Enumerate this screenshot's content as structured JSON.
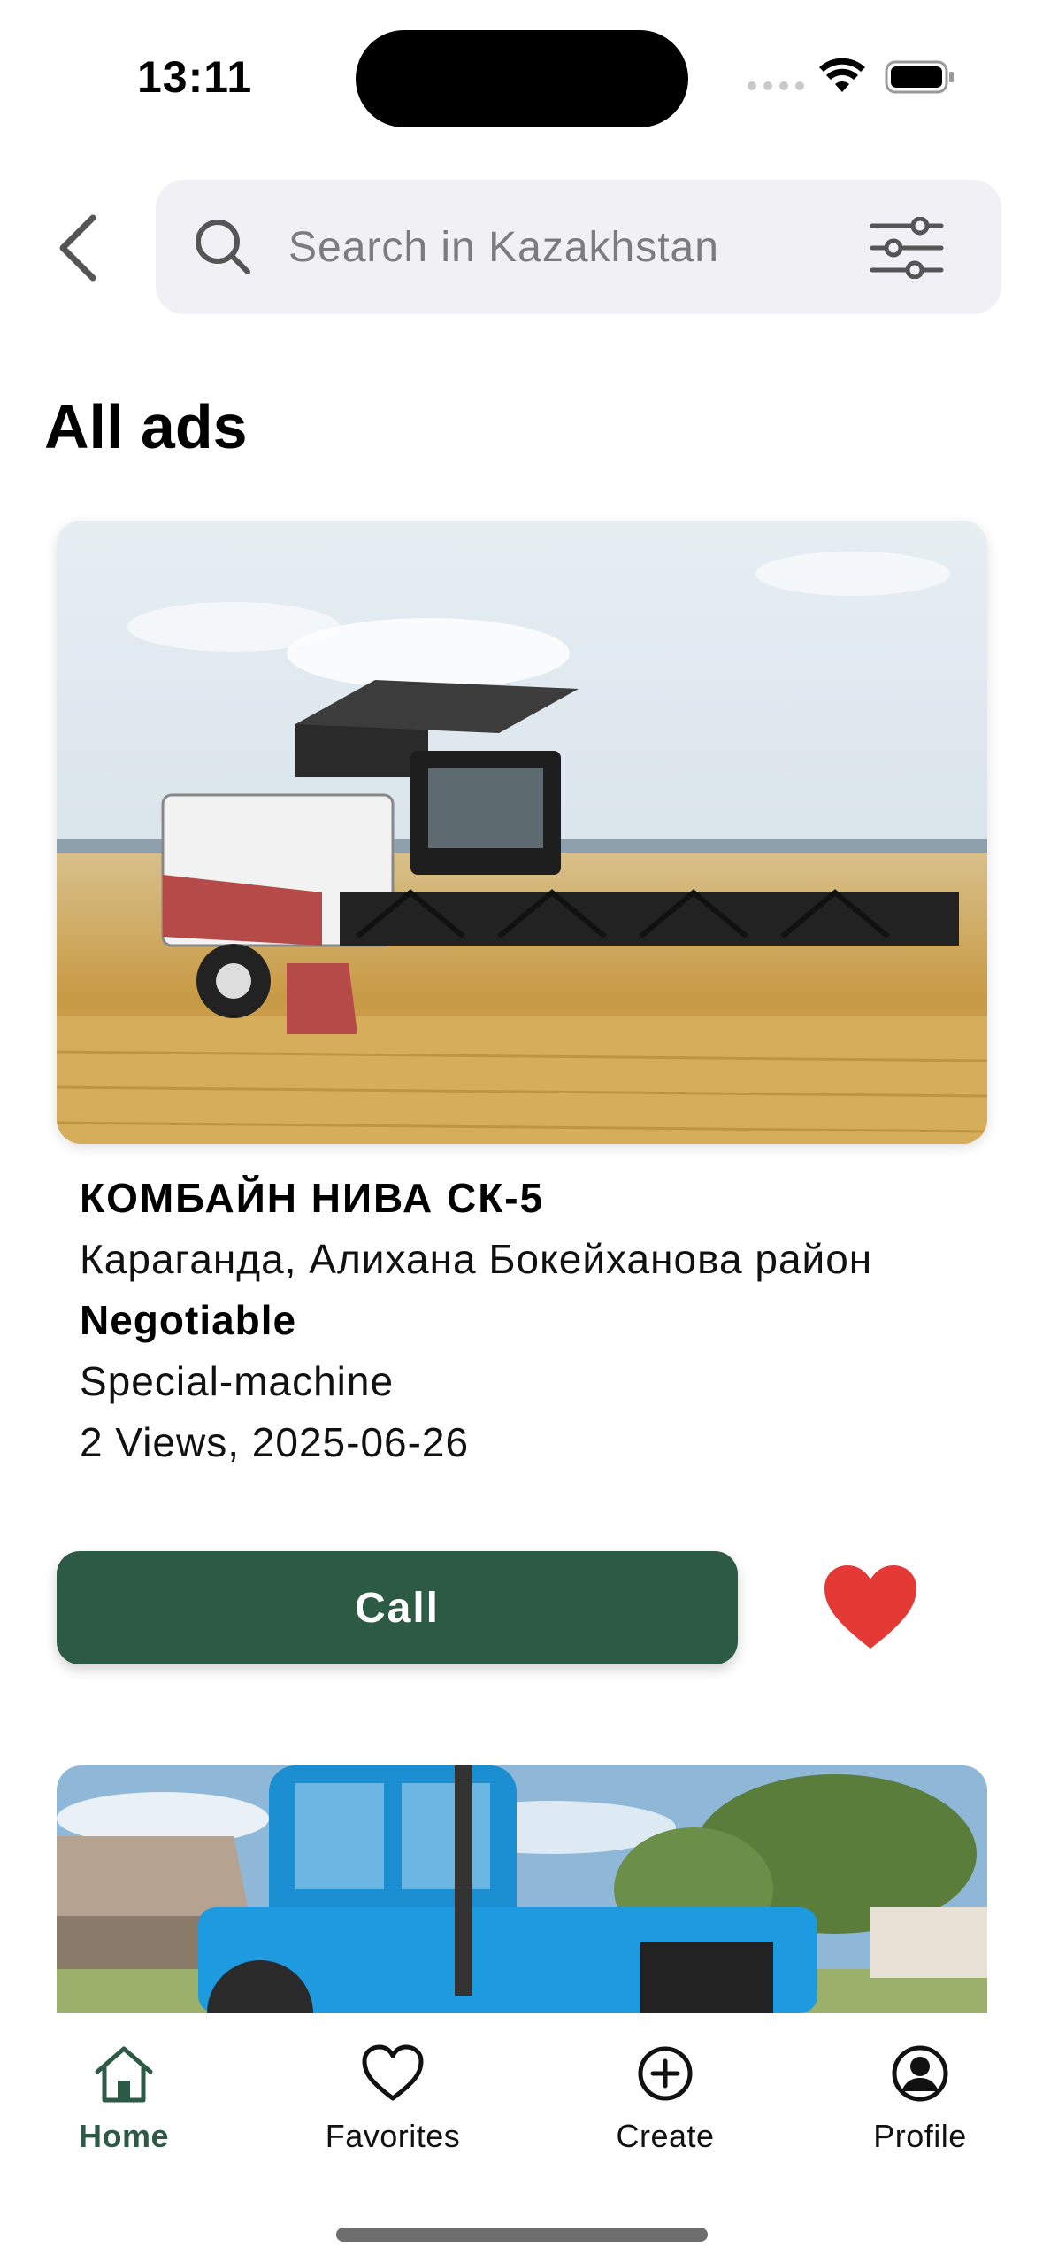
{
  "status_bar": {
    "time": "13:11"
  },
  "search": {
    "placeholder": "Search in Kazakhstan"
  },
  "page": {
    "title": "All ads"
  },
  "ads": [
    {
      "title": "КОМБАЙН НИВА СК-5",
      "location": "Караганда, Алихана Бокейханова район",
      "price": "Negotiable",
      "category": "Special-machine",
      "meta": "2 Views, 2025-06-26",
      "call_label": "Call",
      "favorited": true
    }
  ],
  "bottom_nav": {
    "items": [
      {
        "label": "Home",
        "icon": "home-icon",
        "active": true
      },
      {
        "label": "Favorites",
        "icon": "heart-icon",
        "active": false
      },
      {
        "label": "Create",
        "icon": "plus-circle-icon",
        "active": false
      },
      {
        "label": "Profile",
        "icon": "user-circle-icon",
        "active": false
      }
    ]
  },
  "colors": {
    "primary": "#2d5a45",
    "favorite": "#e53935",
    "search_bg": "#f1f1f5"
  }
}
